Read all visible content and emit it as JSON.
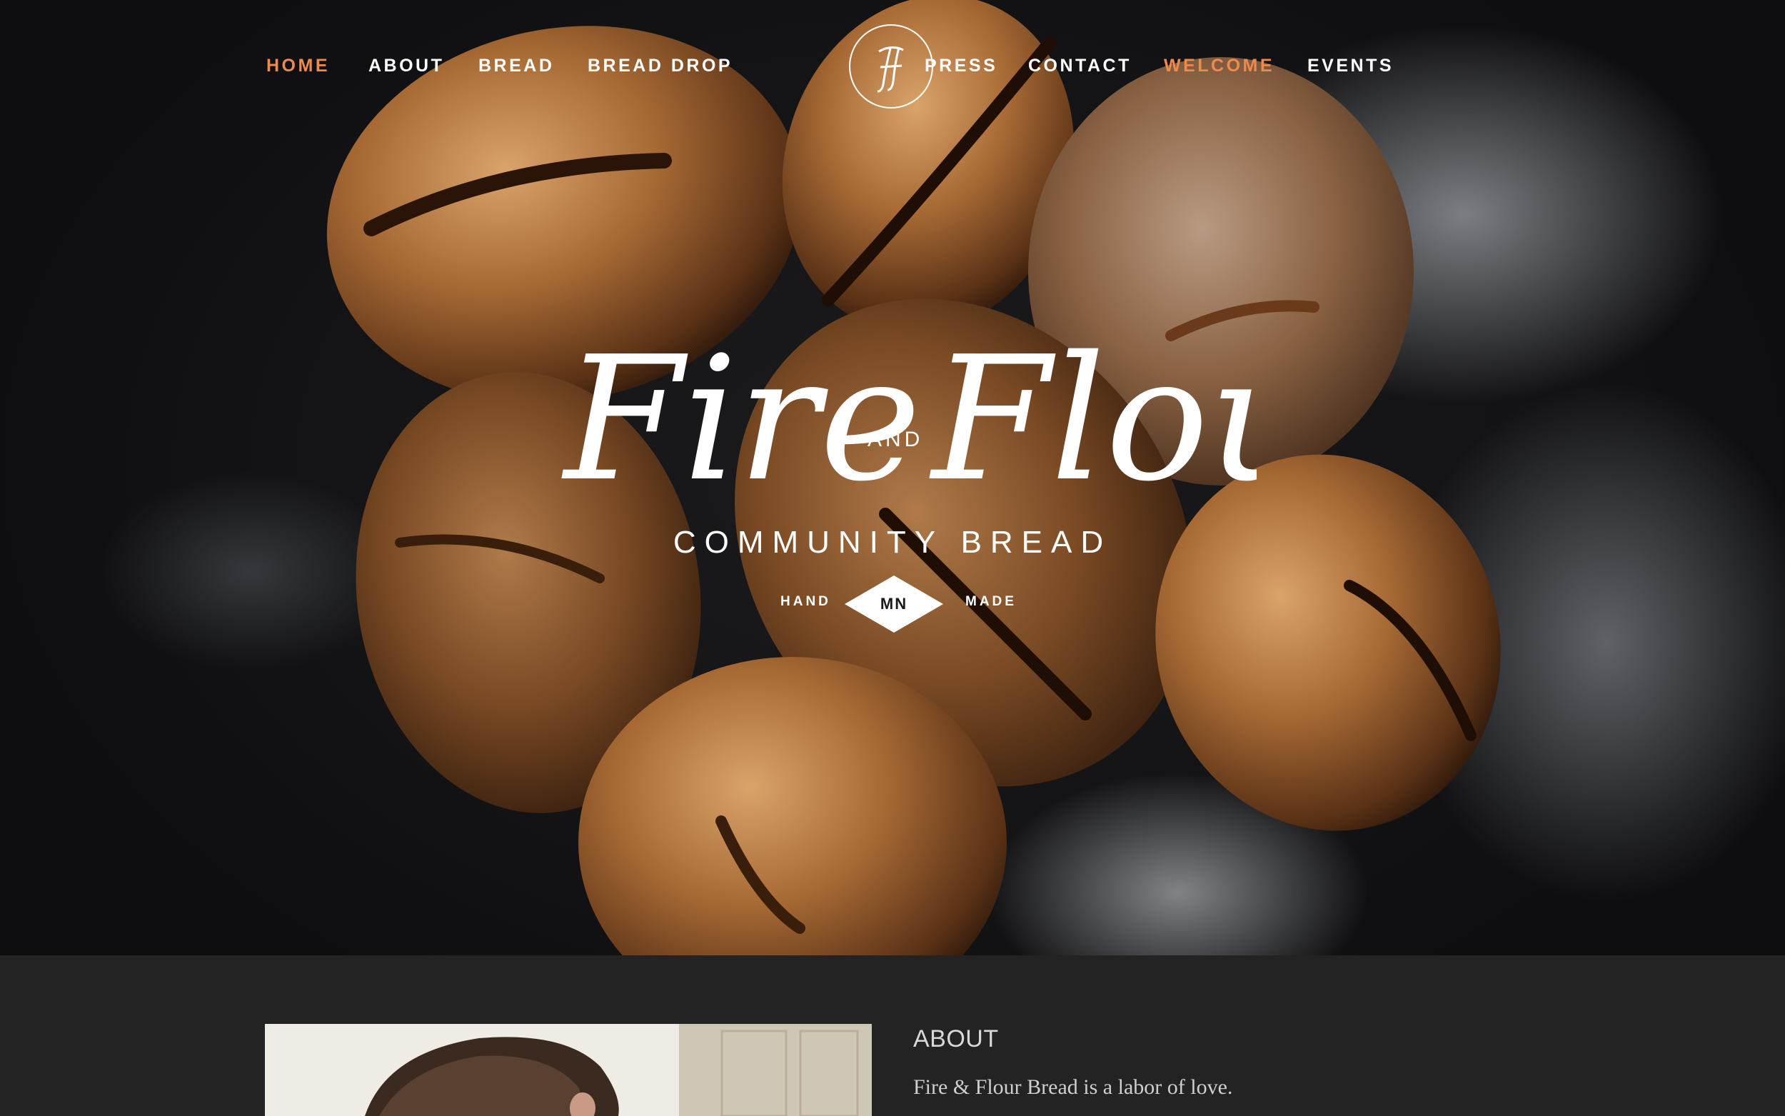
{
  "nav": {
    "items": [
      {
        "label": "HOME",
        "active": true
      },
      {
        "label": "ABOUT",
        "active": false
      },
      {
        "label": "BREAD",
        "active": false
      },
      {
        "label": "BREAD DROP",
        "active": false
      },
      {
        "label": "PRESS",
        "active": false
      },
      {
        "label": "CONTACT",
        "active": false
      },
      {
        "label": "WELCOME",
        "active": true
      },
      {
        "label": "EVENTS",
        "active": false
      }
    ],
    "monogram_icon": "ff-monogram-icon"
  },
  "hero": {
    "logo_word_1": "Fire",
    "logo_and": "AND",
    "logo_word_2": "Flour",
    "tagline": "COMMUNITY BREAD",
    "badge_left": "HAND",
    "badge_center": "MN",
    "badge_right": "MADE"
  },
  "about": {
    "title": "ABOUT",
    "text": "Fire & Flour Bread is a labor of love."
  },
  "colors": {
    "accent": "#ef8a4e",
    "nav_text": "#ffffff",
    "section_bg": "#232323"
  }
}
